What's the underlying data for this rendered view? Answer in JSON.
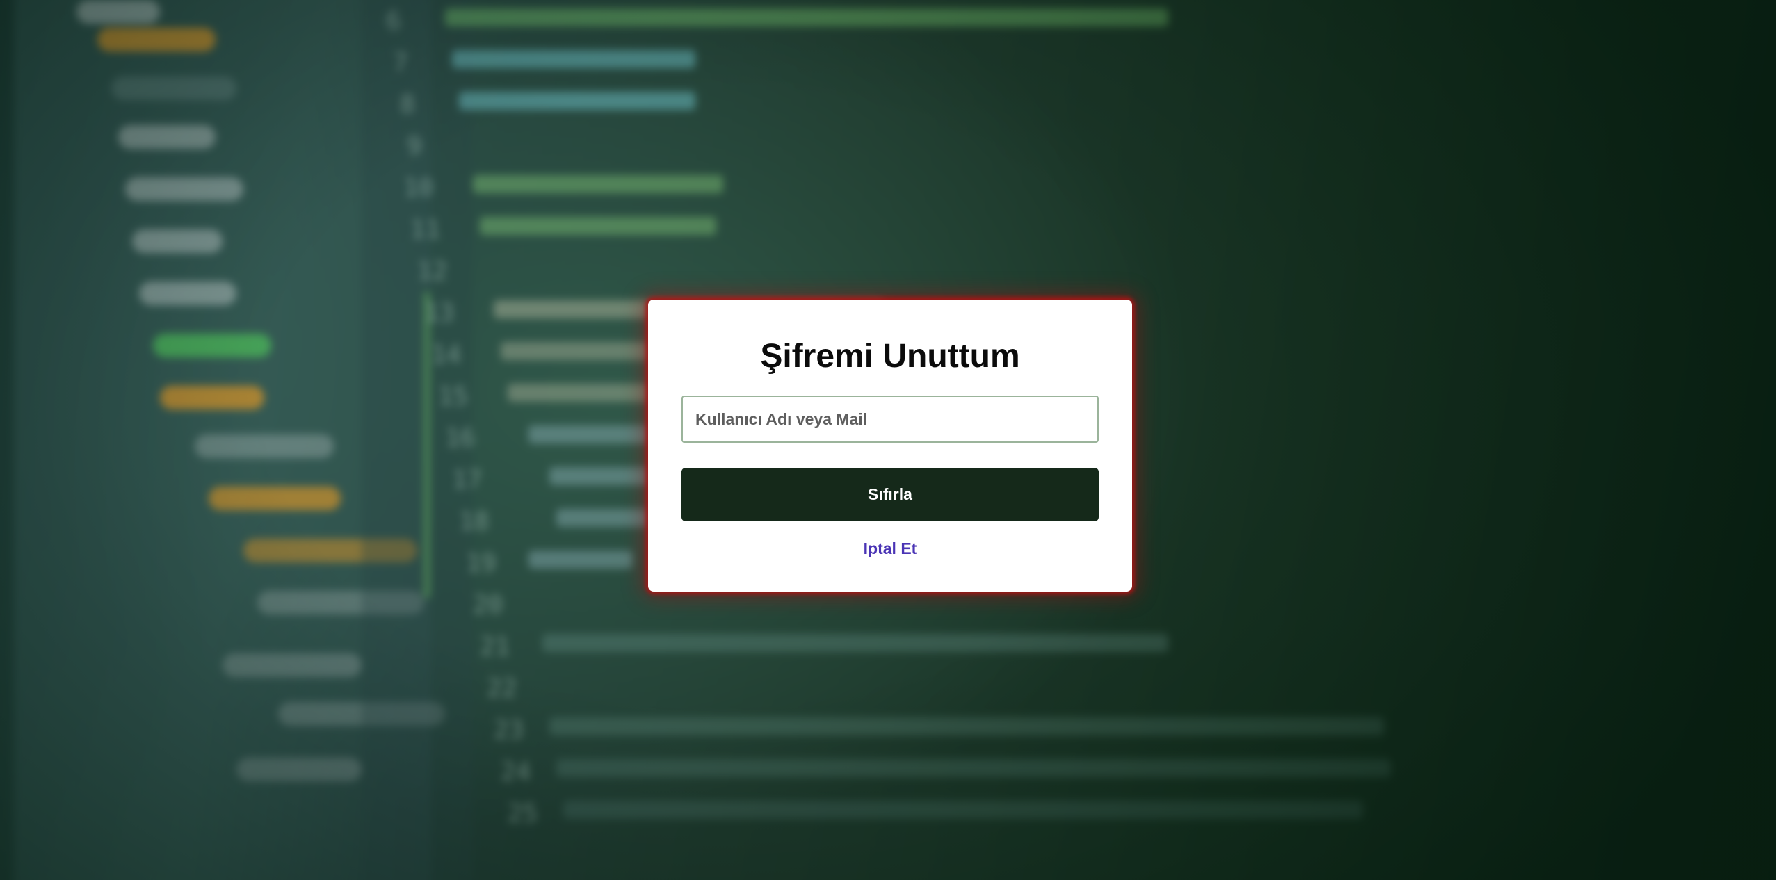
{
  "modal": {
    "title": "Şifremi Unuttum",
    "input_placeholder": "Kullanıcı Adı veya Mail",
    "input_value": "",
    "submit_label": "Sıfırla",
    "cancel_label": "Iptal Et"
  },
  "colors": {
    "button_background": "#15291a",
    "link": "#4a34b5",
    "modal_glow": "#aa1414",
    "input_border": "#9bb49b"
  }
}
